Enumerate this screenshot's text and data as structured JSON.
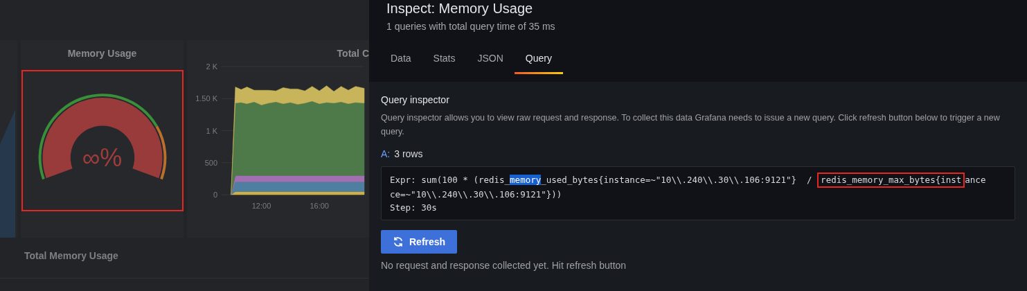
{
  "dashboard": {
    "gauge_panel": {
      "title": "Memory Usage",
      "value": "∞%",
      "level": 1,
      "highlighted": true
    },
    "chart_panel": {
      "title": "Total C",
      "chart_data": {
        "type": "area",
        "stacked": true,
        "x": [
          9.9,
          10.2,
          10.6,
          11,
          11.5,
          12,
          12.5,
          13,
          13.5,
          14,
          14.5,
          15,
          15.5,
          16,
          16.5,
          17,
          17.5,
          18,
          18.5,
          19.1
        ],
        "series": [
          {
            "color": "#c9b04a",
            "values": [
              0,
              50,
              50,
              50,
              50,
              50,
              50,
              50,
              50,
              50,
              50,
              50,
              50,
              50,
              50,
              50,
              50,
              50,
              50,
              50
            ]
          },
          {
            "color": "#4f7fa0",
            "values": [
              0,
              150,
              150,
              150,
              150,
              150,
              150,
              150,
              150,
              150,
              150,
              150,
              150,
              150,
              150,
              150,
              150,
              150,
              150,
              150
            ]
          },
          {
            "color": "#a070b0",
            "values": [
              0,
              100,
              100,
              100,
              100,
              100,
              100,
              100,
              100,
              100,
              100,
              100,
              100,
              100,
              100,
              100,
              100,
              100,
              100,
              100
            ]
          },
          {
            "color": "#4e7a4a",
            "values": [
              0,
              1130,
              1140,
              1120,
              1150,
              1100,
              1130,
              1150,
              1120,
              1140,
              1110,
              1130,
              1160,
              1120,
              1140,
              1130,
              1150,
              1120,
              1140,
              1130
            ]
          },
          {
            "color": "#c8b45a",
            "values": [
              0,
              250,
              200,
              260,
              180,
              230,
              200,
              170,
              250,
              210,
              240,
              190,
              230,
              200,
              260,
              180,
              240,
              210,
              250,
              230
            ]
          }
        ],
        "grid": true,
        "xlim": [
          9.25,
          19.1
        ],
        "ylim": [
          0,
          2000
        ],
        "xticks": [
          {
            "value": 12,
            "label": "12:00"
          },
          {
            "value": 16,
            "label": "16:00"
          }
        ],
        "yticks": [
          {
            "value": 0,
            "label": "0"
          },
          {
            "value": 500,
            "label": "500"
          },
          {
            "value": 1000,
            "label": "1 K"
          },
          {
            "value": 1500,
            "label": "1.50 K"
          },
          {
            "value": 2000,
            "label": "2 K"
          }
        ]
      }
    },
    "row_title": "Total Memory Usage"
  },
  "inspect": {
    "title": "Inspect: Memory Usage",
    "subtitle": "1 queries with total query time of 35 ms",
    "tabs": [
      {
        "label": "Data",
        "selected": false
      },
      {
        "label": "Stats",
        "selected": false
      },
      {
        "label": "JSON",
        "selected": false
      },
      {
        "label": "Query",
        "selected": true
      }
    ],
    "section_title": "Query inspector",
    "description": "Query inspector allows you to view raw request and response. To collect this data Grafana needs to issue a new query. Click refresh button below to trigger a new query.",
    "result": {
      "label": "A:",
      "rows": "3 rows"
    },
    "query_lines": [
      [
        {
          "kind": "plain",
          "text": "Expr: sum(100 * (redis_"
        },
        {
          "kind": "selected",
          "text": "memory"
        },
        {
          "kind": "plain",
          "text": "_used_bytes{instance=~\"10\\\\.240\\\\.30\\\\.106:9121\"}  / "
        },
        {
          "kind": "boxed",
          "text": "redis_memory_max_bytes{inst"
        },
        {
          "kind": "plain",
          "text": "ance"
        }
      ],
      [
        {
          "kind": "plain",
          "text": "ce=~\"10\\\\.240\\\\.30\\\\.106:9121\"}))"
        }
      ],
      [
        {
          "kind": "plain",
          "text": "Step: 30s"
        }
      ]
    ],
    "button": "Refresh",
    "status": "No request and response collected yet. Hit refresh button"
  }
}
